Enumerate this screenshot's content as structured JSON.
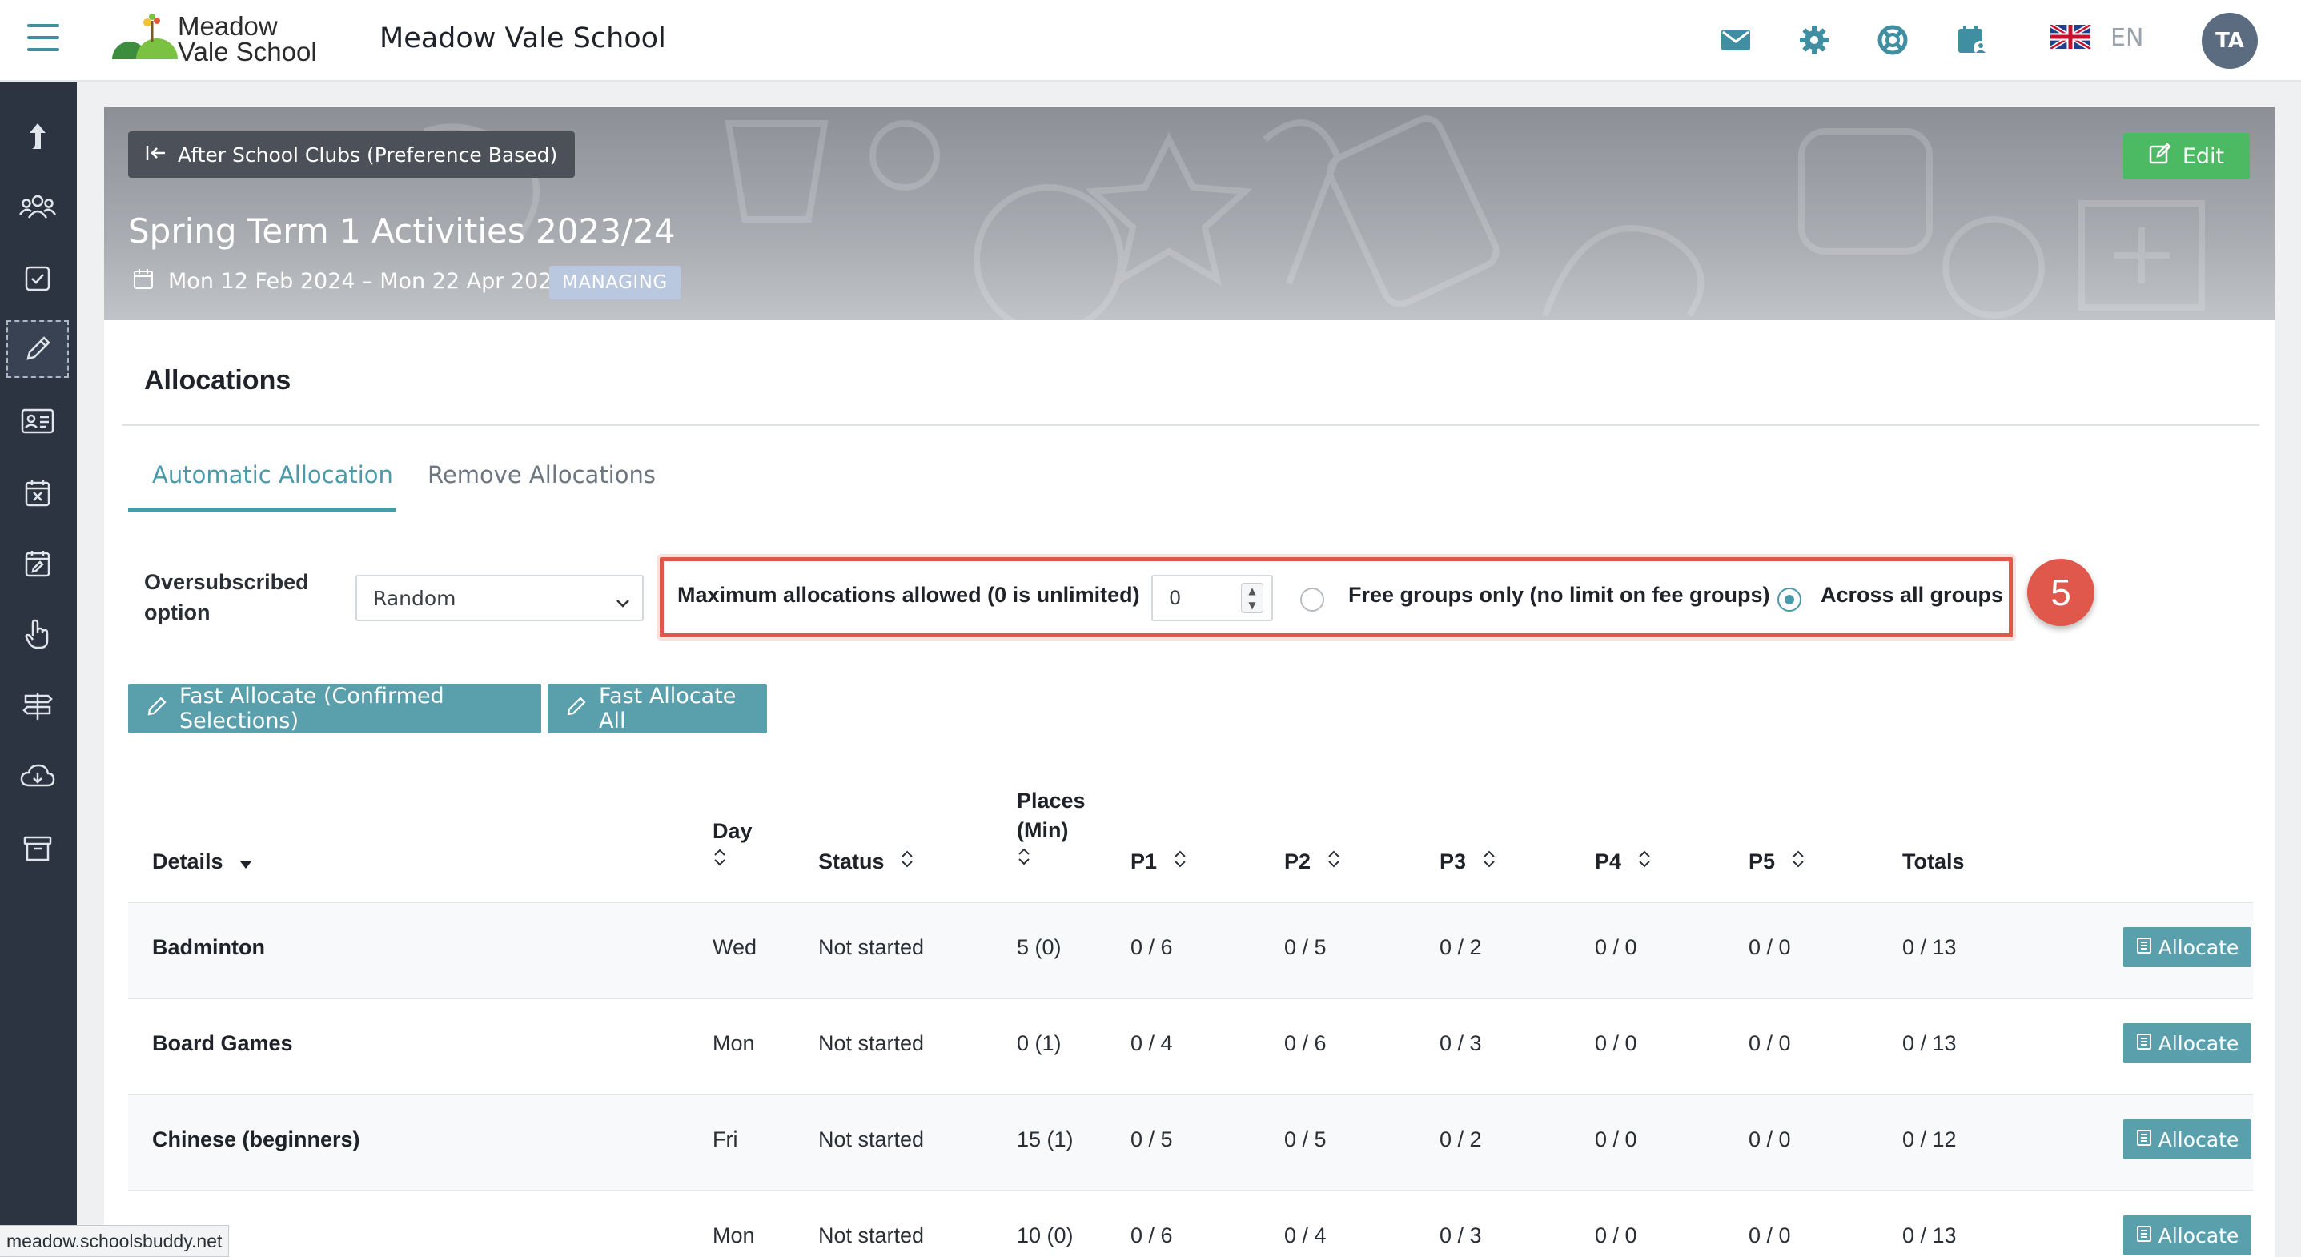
{
  "header": {
    "logo_line1": "Meadow",
    "logo_line2": "Vale School",
    "school_name": "Meadow Vale School",
    "lang_code": "EN",
    "avatar_initials": "TA",
    "icons": [
      "envelope-icon",
      "gear-icon",
      "lifebuoy-icon",
      "calendar-user-icon",
      "uk-flag-icon"
    ]
  },
  "sidebar": {
    "items": [
      "share-icon",
      "users-icon",
      "checkbox-icon",
      "pencil-icon",
      "id-card-icon",
      "calendar-x-icon",
      "calendar-edit-icon",
      "hand-pointer-icon",
      "signpost-icon",
      "cloud-download-icon",
      "archive-icon"
    ],
    "active_index": 3
  },
  "banner": {
    "back_label": "After School Clubs (Preference Based)",
    "edit_label": "Edit",
    "title": "Spring Term 1 Activities 2023/24",
    "dates": "Mon 12 Feb 2024 – Mon 22 Apr 2024",
    "badge": "MANAGING"
  },
  "allocations": {
    "title": "Allocations",
    "tabs": [
      {
        "label": "Automatic Allocation",
        "active": true
      },
      {
        "label": "Remove Allocations",
        "active": false
      }
    ],
    "oversubscribed_label_line1": "Oversubscribed",
    "oversubscribed_label_line2": "option",
    "oversubscribed_value": "Random",
    "max_label": "Maximum allocations allowed (0 is unlimited)",
    "max_value": "0",
    "radio_free": "Free groups only (no limit on fee groups)",
    "radio_all": "Across all groups",
    "radio_selected": "Across all groups",
    "step_number": "5",
    "btn_fast_confirmed": "Fast Allocate (Confirmed Selections)",
    "btn_fast_all": "Fast Allocate All"
  },
  "table": {
    "headers": {
      "details": "Details",
      "day": "Day",
      "status": "Status",
      "places_line1": "Places",
      "places_line2": "(Min)",
      "p1": "P1",
      "p2": "P2",
      "p3": "P3",
      "p4": "P4",
      "p5": "P5",
      "totals": "Totals"
    },
    "allocate_label": "Allocate",
    "rows": [
      {
        "name": "Badminton",
        "day": "Wed",
        "status": "Not started",
        "places": "5 (0)",
        "p1": "0 / 6",
        "p2": "0 / 5",
        "p3": "0 / 2",
        "p4": "0 / 0",
        "p5": "0 / 0",
        "totals": "0 / 13"
      },
      {
        "name": "Board Games",
        "day": "Mon",
        "status": "Not started",
        "places": "0 (1)",
        "p1": "0 / 4",
        "p2": "0 / 6",
        "p3": "0 / 3",
        "p4": "0 / 0",
        "p5": "0 / 0",
        "totals": "0 / 13"
      },
      {
        "name": "Chinese (beginners)",
        "day": "Fri",
        "status": "Not started",
        "places": "15 (1)",
        "p1": "0 / 5",
        "p2": "0 / 5",
        "p3": "0 / 2",
        "p4": "0 / 0",
        "p5": "0 / 0",
        "totals": "0 / 12"
      },
      {
        "name": "",
        "day": "Mon",
        "status": "Not started",
        "places": "10 (0)",
        "p1": "0 / 6",
        "p2": "0 / 4",
        "p3": "0 / 3",
        "p4": "0 / 0",
        "p5": "0 / 0",
        "totals": "0 / 13"
      }
    ]
  },
  "status_bar": {
    "url": "meadow.schoolsbuddy.net"
  },
  "colors": {
    "accent": "#4a9aab",
    "button_teal": "#5a9fac",
    "edit_green": "#4cb963",
    "highlight_red": "#e0574b",
    "sidebar": "#2c3441"
  }
}
